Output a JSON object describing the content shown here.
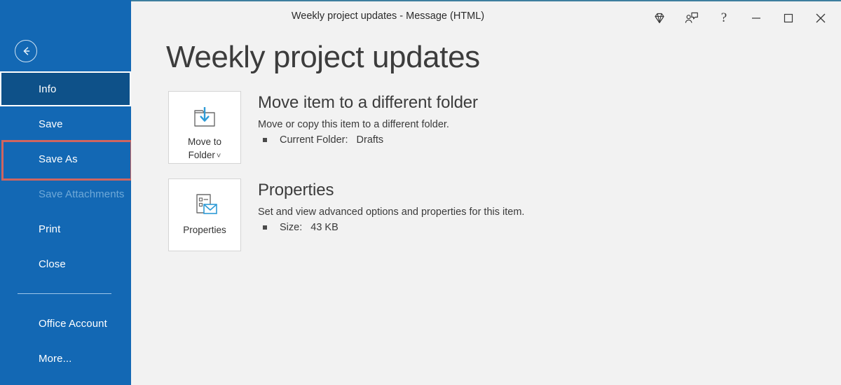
{
  "window": {
    "title_document": "Weekly project updates",
    "title_separator": "-",
    "title_type": "Message (HTML)",
    "controls": [
      {
        "name": "diamond-icon",
        "label": ""
      },
      {
        "name": "person-feedback-icon",
        "label": ""
      },
      {
        "name": "help-icon",
        "label": "?"
      },
      {
        "name": "minimize-icon",
        "label": ""
      },
      {
        "name": "maximize-icon",
        "label": ""
      },
      {
        "name": "close-icon",
        "label": ""
      }
    ]
  },
  "sidebar": {
    "back_label": "Back",
    "accent_color": "#1368b4",
    "active_color": "#0e5189",
    "highlight_color": "#cf6560",
    "items": [
      {
        "label": "Info",
        "state": "active"
      },
      {
        "label": "Save",
        "state": "normal"
      },
      {
        "label": "Save As",
        "state": "highlight"
      },
      {
        "label": "Save Attachments",
        "state": "disabled"
      },
      {
        "label": "Print",
        "state": "normal"
      },
      {
        "label": "Close",
        "state": "normal"
      },
      {
        "label": "Office Account",
        "state": "normal"
      },
      {
        "label": "More...",
        "state": "normal"
      }
    ]
  },
  "main": {
    "page_title": "Weekly project updates",
    "sections": [
      {
        "tile_label_line1": "Move to",
        "tile_label_line2": "Folder",
        "tile_caret": "˅",
        "tile_icon": "move-to-folder-icon",
        "heading": "Move item to a different folder",
        "description": "Move or copy this item to a different folder.",
        "detail_label": "Current Folder:",
        "detail_value": "Drafts"
      },
      {
        "tile_label_line1": "Properties",
        "tile_label_line2": "",
        "tile_caret": "",
        "tile_icon": "properties-icon",
        "heading": "Properties",
        "description": "Set and view advanced options and properties for this item.",
        "detail_label": "Size:",
        "detail_value": "43 KB"
      }
    ]
  }
}
